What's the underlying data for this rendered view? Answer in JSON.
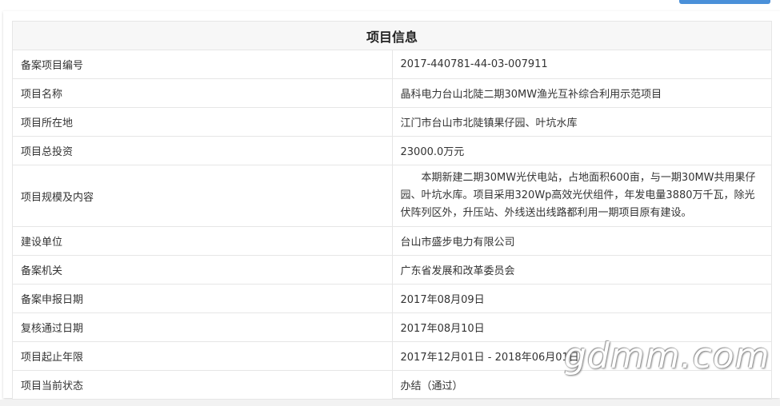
{
  "title": "项目信息",
  "rows": [
    {
      "label": "备案项目编号",
      "value": "2017-440781-44-03-007911"
    },
    {
      "label": "项目名称",
      "value": "晶科电力台山北陡二期30MW渔光互补综合利用示范项目"
    },
    {
      "label": "项目所在地",
      "value": "江门市台山市北陡镇果仔园、叶坑水库"
    },
    {
      "label": "项目总投资",
      "value": "23000.0万元"
    },
    {
      "label": "项目规模及内容",
      "value": "本期新建二期30MW光伏电站，占地面积600亩，与一期30MW共用果仔园、叶坑水库。项目采用320Wp高效光伏组件，年发电量3880万千瓦，除光伏阵列区外，升压站、外线送出线路都利用一期项目原有建设。"
    },
    {
      "label": "建设单位",
      "value": "台山市盛步电力有限公司"
    },
    {
      "label": "备案机关",
      "value": "广东省发展和改革委员会"
    },
    {
      "label": "备案申报日期",
      "value": "2017年08月09日"
    },
    {
      "label": "复核通过日期",
      "value": "2017年08月10日"
    },
    {
      "label": "项目起止年限",
      "value": "2017年12月01日 - 2018年06月01日"
    },
    {
      "label": "项目当前状态",
      "value": "办结（通过）"
    }
  ],
  "watermark": "gdmm.com"
}
